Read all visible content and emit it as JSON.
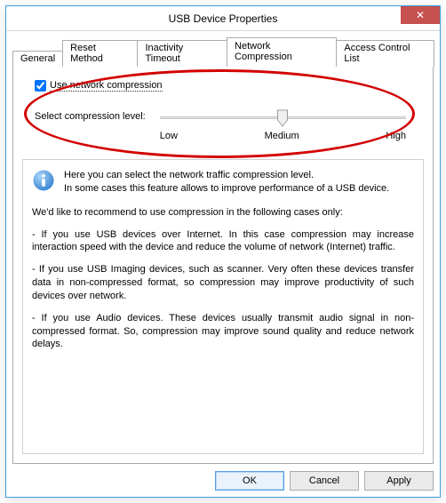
{
  "window": {
    "title": "USB Device Properties"
  },
  "tabs": {
    "t0": "General",
    "t1": "Reset Method",
    "t2": "Inactivity Timeout",
    "t3": "Network Compression",
    "t4": "Access Control List"
  },
  "panel": {
    "checkbox_label": "Use network compression",
    "checkbox_checked": true,
    "slider_label": "Select compression level:",
    "ticks": {
      "low": "Low",
      "medium": "Medium",
      "high": "High"
    }
  },
  "info": {
    "line1": "Here you can select the network traffic compression level.",
    "line2": "In some cases this feature allows to improve performance of a USB device.",
    "p1": "We'd like to recommend to use compression in the following cases only:",
    "p2": "- If you use USB devices over Internet. In this case compression may increase interaction speed with the device and reduce the volume of network (Internet) traffic.",
    "p3": "- If you use USB Imaging devices, such as scanner. Very often these devices transfer data in non-compressed format, so compression may improve productivity of such devices over network.",
    "p4": "- If you use Audio devices. These devices usually transmit audio signal in non-compressed format. So, compression may improve sound quality and reduce network delays."
  },
  "buttons": {
    "ok": "OK",
    "cancel": "Cancel",
    "apply": "Apply"
  }
}
